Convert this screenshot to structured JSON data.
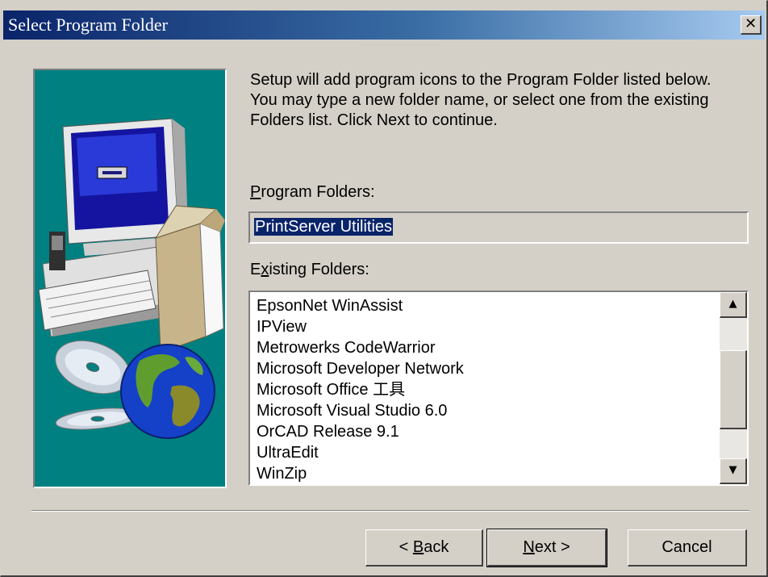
{
  "window": {
    "title": "Select Program Folder",
    "close_glyph": "✕"
  },
  "intro": {
    "lines": [
      "Setup will add program icons to the Program Folder listed below.",
      "You may type a new folder name, or select one from the existing",
      "Folders list.  Click Next to continue."
    ]
  },
  "program_folders": {
    "label_prefix": "",
    "label_accel": "P",
    "label_rest": "rogram Folders:",
    "value": "PrintServer Utilities"
  },
  "existing_folders": {
    "label_prefix": "E",
    "label_accel": "x",
    "label_rest": "isting Folders:",
    "items": [
      "EpsonNet WinAssist",
      "IPView",
      "Metrowerks CodeWarrior",
      "Microsoft Developer Network",
      "Microsoft Office 工具",
      "Microsoft Visual Studio 6.0",
      "OrCAD Release 9.1",
      "UltraEdit",
      "WinZip"
    ],
    "scroll_up_glyph": "▲",
    "scroll_down_glyph": "▼"
  },
  "buttons": {
    "back": {
      "prefix": "< ",
      "accel": "B",
      "rest": "ack"
    },
    "next": {
      "prefix": "",
      "accel": "N",
      "rest": "ext >"
    },
    "cancel": {
      "label": "Cancel"
    }
  },
  "icons": [
    "computer-icon",
    "cd-icon",
    "globe-icon",
    "box-icon"
  ],
  "colors": {
    "titlebar_start": "#0a246a",
    "titlebar_end": "#a6caf0",
    "art_bg": "#008080",
    "face": "#d4d0c8",
    "selection": "#0a246a"
  }
}
